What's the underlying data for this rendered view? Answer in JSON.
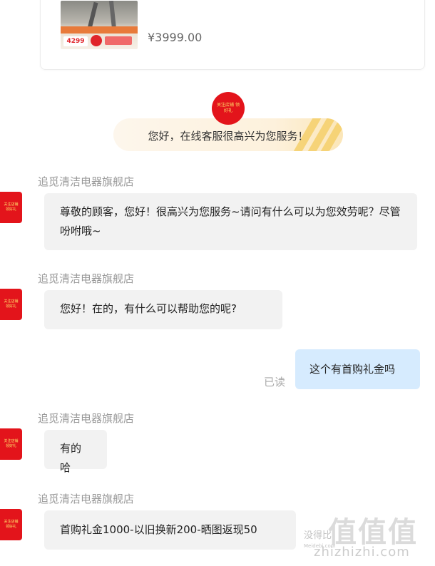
{
  "product": {
    "price": "¥3999.00",
    "thumb_price": "4299"
  },
  "welcome": {
    "avatar_text": "关注店铺 领好礼",
    "message": "您好，在线客服很高兴为您服务！"
  },
  "messages": [
    {
      "sender": "追觅清洁电器旗舰店",
      "text": "尊敬的顾客，您好！很高兴为您服务~请问有什么可以为您效劳呢？尽管吩咐哦~"
    },
    {
      "sender": "追觅清洁电器旗舰店",
      "text": "您好！在的，有什么可以帮助您的呢?"
    },
    {
      "sender": "me",
      "text": "这个有首购礼金吗",
      "status": "已读"
    },
    {
      "sender": "追觅清洁电器旗舰店",
      "text": "有的哈"
    },
    {
      "sender": "追觅清洁电器旗舰店",
      "text": "首购礼金1000-以旧换新200-晒图返现50"
    }
  ],
  "avatar_label": "关注店铺 领好礼",
  "watermark": {
    "logo": "值值值",
    "cn": "没得比",
    "url": "zhizhizhi.com",
    "small": "Meidebi.com"
  }
}
